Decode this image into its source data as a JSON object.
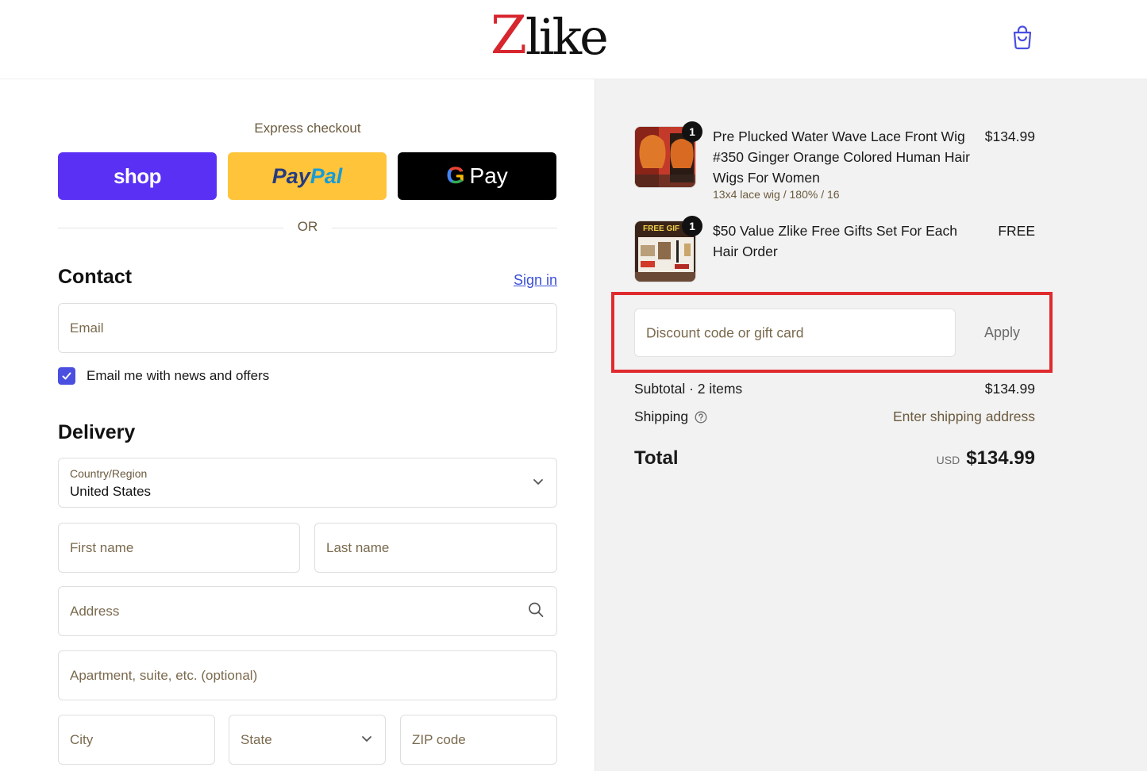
{
  "header": {
    "logo_z": "Z",
    "logo_rest": "like",
    "cart_icon": "shopping-bag-icon"
  },
  "express": {
    "title": "Express checkout",
    "shop_label": "shop",
    "paypal_part1": "Pay",
    "paypal_part2": "Pal",
    "gpay_g": "G",
    "gpay_label": "Pay",
    "or": "OR"
  },
  "contact": {
    "title": "Contact",
    "signin": "Sign in",
    "email_placeholder": "Email",
    "newsletter_label": "Email me with news and offers",
    "newsletter_checked": true
  },
  "delivery": {
    "title": "Delivery",
    "country_label": "Country/Region",
    "country_value": "United States",
    "first_name": "First name",
    "last_name": "Last name",
    "address": "Address",
    "apartment": "Apartment, suite, etc. (optional)",
    "city": "City",
    "state": "State",
    "zip": "ZIP code"
  },
  "cart": {
    "items": [
      {
        "qty": "1",
        "title": "Pre Plucked Water Wave Lace Front Wig #350 Ginger Orange Colored Human Hair Wigs For Women",
        "variant": "13x4 lace wig / 180% / 16",
        "price": "$134.99"
      },
      {
        "qty": "1",
        "title": "$50 Value Zlike Free Gifts Set For Each Hair Order",
        "thumb_text": "FREE GIF",
        "price": "FREE"
      }
    ],
    "discount_placeholder": "Discount code or gift card",
    "apply": "Apply",
    "subtotal_label": "Subtotal · 2 items",
    "subtotal_value": "$134.99",
    "shipping_label": "Shipping",
    "shipping_value": "Enter shipping address",
    "total_label": "Total",
    "currency": "USD",
    "total_value": "$134.99"
  },
  "colors": {
    "shop": "#5a31f4",
    "paypal": "#ffc439",
    "gpay": "#000000",
    "accent": "#4a4fe0",
    "highlight": "#e02b2e",
    "logo_red": "#d7262e"
  }
}
